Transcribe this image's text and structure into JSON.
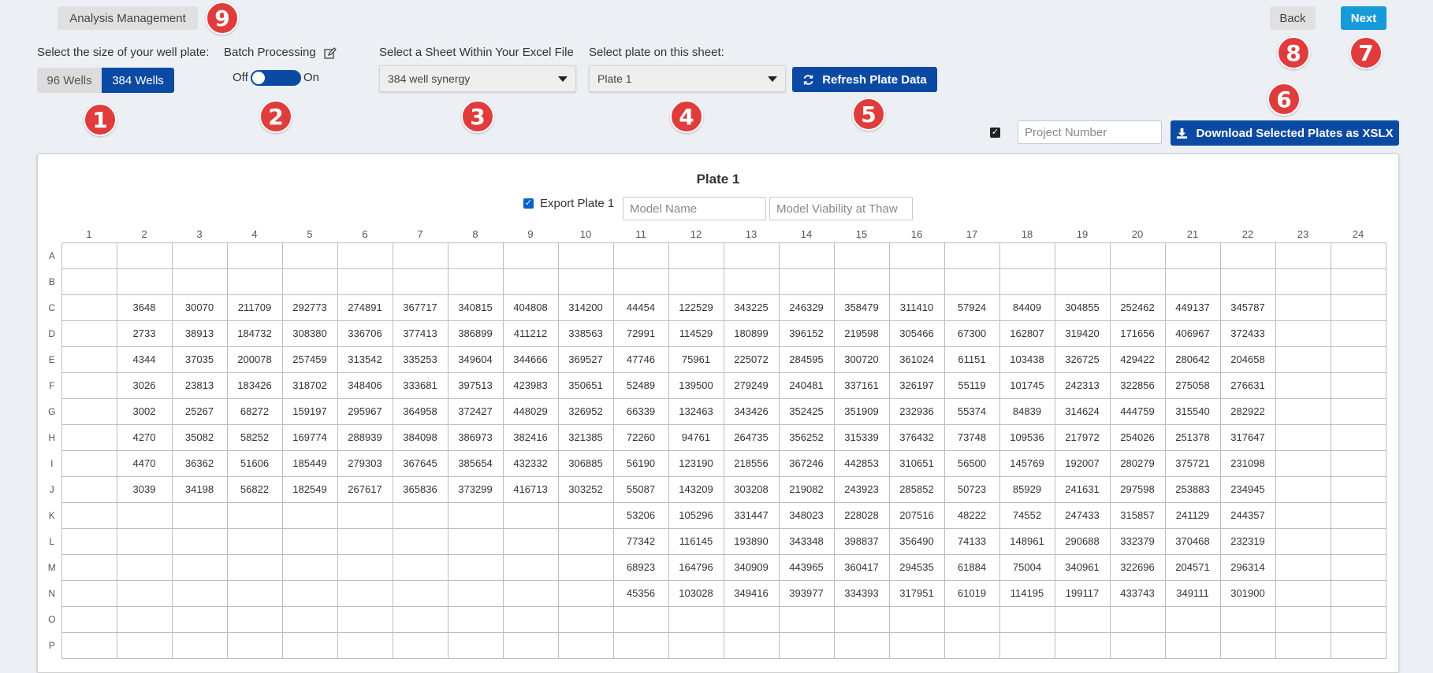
{
  "header": {
    "analysis_management": "Analysis Management",
    "back": "Back",
    "next": "Next"
  },
  "well_size": {
    "label": "Select the size of your well plate:",
    "option_96": "96 Wells",
    "option_384": "384 Wells",
    "selected": "384 Wells"
  },
  "batch": {
    "label": "Batch Processing",
    "off": "Off",
    "on": "On"
  },
  "sheet": {
    "label": "Select a Sheet Within Your Excel File",
    "value": "384 well synergy"
  },
  "plate_select": {
    "label": "Select plate on this sheet:",
    "value": "Plate 1"
  },
  "refresh_button": "Refresh Plate Data",
  "project_number": {
    "placeholder": "Project Number"
  },
  "download_button": "Download Selected Plates as XSLX",
  "markers": [
    "1",
    "2",
    "3",
    "4",
    "5",
    "6",
    "7",
    "8",
    "9"
  ],
  "plate": {
    "title": "Plate 1",
    "export_label": "Export Plate 1",
    "model_name_placeholder": "Model Name",
    "model_viability_placeholder": "Model Viability at Thaw",
    "columns": [
      "1",
      "2",
      "3",
      "4",
      "5",
      "6",
      "7",
      "8",
      "9",
      "10",
      "11",
      "12",
      "13",
      "14",
      "15",
      "16",
      "17",
      "18",
      "19",
      "20",
      "21",
      "22",
      "23",
      "24"
    ],
    "rows": [
      {
        "label": "A",
        "cells": [
          "",
          "",
          "",
          "",
          "",
          "",
          "",
          "",
          "",
          "",
          "",
          "",
          "",
          "",
          "",
          "",
          "",
          "",
          "",
          "",
          "",
          "",
          "",
          ""
        ]
      },
      {
        "label": "B",
        "cells": [
          "",
          "",
          "",
          "",
          "",
          "",
          "",
          "",
          "",
          "",
          "",
          "",
          "",
          "",
          "",
          "",
          "",
          "",
          "",
          "",
          "",
          "",
          "",
          ""
        ]
      },
      {
        "label": "C",
        "cells": [
          "",
          "3648",
          "30070",
          "211709",
          "292773",
          "274891",
          "367717",
          "340815",
          "404808",
          "314200",
          "44454",
          "122529",
          "343225",
          "246329",
          "358479",
          "311410",
          "57924",
          "84409",
          "304855",
          "252462",
          "449137",
          "345787",
          "",
          ""
        ]
      },
      {
        "label": "D",
        "cells": [
          "",
          "2733",
          "38913",
          "184732",
          "308380",
          "336706",
          "377413",
          "386899",
          "411212",
          "338563",
          "72991",
          "114529",
          "180899",
          "396152",
          "219598",
          "305466",
          "67300",
          "162807",
          "319420",
          "171656",
          "406967",
          "372433",
          "",
          ""
        ]
      },
      {
        "label": "E",
        "cells": [
          "",
          "4344",
          "37035",
          "200078",
          "257459",
          "313542",
          "335253",
          "349604",
          "344666",
          "369527",
          "47746",
          "75961",
          "225072",
          "284595",
          "300720",
          "361024",
          "61151",
          "103438",
          "326725",
          "429422",
          "280642",
          "204658",
          "",
          ""
        ]
      },
      {
        "label": "F",
        "cells": [
          "",
          "3026",
          "23813",
          "183426",
          "318702",
          "348406",
          "333681",
          "397513",
          "423983",
          "350651",
          "52489",
          "139500",
          "279249",
          "240481",
          "337161",
          "326197",
          "55119",
          "101745",
          "242313",
          "322856",
          "275058",
          "276631",
          "",
          ""
        ]
      },
      {
        "label": "G",
        "cells": [
          "",
          "3002",
          "25267",
          "68272",
          "159197",
          "295967",
          "364958",
          "372427",
          "448029",
          "326952",
          "66339",
          "132463",
          "343426",
          "352425",
          "351909",
          "232936",
          "55374",
          "84839",
          "314624",
          "444759",
          "315540",
          "282922",
          "",
          ""
        ]
      },
      {
        "label": "H",
        "cells": [
          "",
          "4270",
          "35082",
          "58252",
          "169774",
          "288939",
          "384098",
          "386973",
          "382416",
          "321385",
          "72260",
          "94761",
          "264735",
          "356252",
          "315339",
          "376432",
          "73748",
          "109536",
          "217972",
          "254026",
          "251378",
          "317647",
          "",
          ""
        ]
      },
      {
        "label": "I",
        "cells": [
          "",
          "4470",
          "36362",
          "51606",
          "185449",
          "279303",
          "367645",
          "385654",
          "432332",
          "306885",
          "56190",
          "123190",
          "218556",
          "367246",
          "442853",
          "310651",
          "56500",
          "145769",
          "192007",
          "280279",
          "375721",
          "231098",
          "",
          ""
        ]
      },
      {
        "label": "J",
        "cells": [
          "",
          "3039",
          "34198",
          "56822",
          "182549",
          "267617",
          "365836",
          "373299",
          "416713",
          "303252",
          "55087",
          "143209",
          "303208",
          "219082",
          "243923",
          "285852",
          "50723",
          "85929",
          "241631",
          "297598",
          "253883",
          "234945",
          "",
          ""
        ]
      },
      {
        "label": "K",
        "cells": [
          "",
          "",
          "",
          "",
          "",
          "",
          "",
          "",
          "",
          "",
          "53206",
          "105296",
          "331447",
          "348023",
          "228028",
          "207516",
          "48222",
          "74552",
          "247433",
          "315857",
          "241129",
          "244357",
          "",
          ""
        ]
      },
      {
        "label": "L",
        "cells": [
          "",
          "",
          "",
          "",
          "",
          "",
          "",
          "",
          "",
          "",
          "77342",
          "116145",
          "193890",
          "343348",
          "398837",
          "356490",
          "74133",
          "148961",
          "290688",
          "332379",
          "370468",
          "232319",
          "",
          ""
        ]
      },
      {
        "label": "M",
        "cells": [
          "",
          "",
          "",
          "",
          "",
          "",
          "",
          "",
          "",
          "",
          "68923",
          "164796",
          "340909",
          "443965",
          "360417",
          "294535",
          "61884",
          "75004",
          "340961",
          "322696",
          "204571",
          "296314",
          "",
          ""
        ]
      },
      {
        "label": "N",
        "cells": [
          "",
          "",
          "",
          "",
          "",
          "",
          "",
          "",
          "",
          "",
          "45356",
          "103028",
          "349416",
          "393977",
          "334393",
          "317951",
          "61019",
          "114195",
          "199117",
          "433743",
          "349111",
          "301900",
          "",
          ""
        ]
      },
      {
        "label": "O",
        "cells": [
          "",
          "",
          "",
          "",
          "",
          "",
          "",
          "",
          "",
          "",
          "",
          "",
          "",
          "",
          "",
          "",
          "",
          "",
          "",
          "",
          "",
          "",
          "",
          ""
        ]
      },
      {
        "label": "P",
        "cells": [
          "",
          "",
          "",
          "",
          "",
          "",
          "",
          "",
          "",
          "",
          "",
          "",
          "",
          "",
          "",
          "",
          "",
          "",
          "",
          "",
          "",
          "",
          "",
          ""
        ]
      }
    ]
  },
  "icons": {
    "edit": "edit-icon",
    "refresh": "refresh-icon",
    "download": "download-icon"
  },
  "colors": {
    "primary": "#0b4aa2",
    "next": "#169bd8",
    "marker": "#e03c3c"
  }
}
